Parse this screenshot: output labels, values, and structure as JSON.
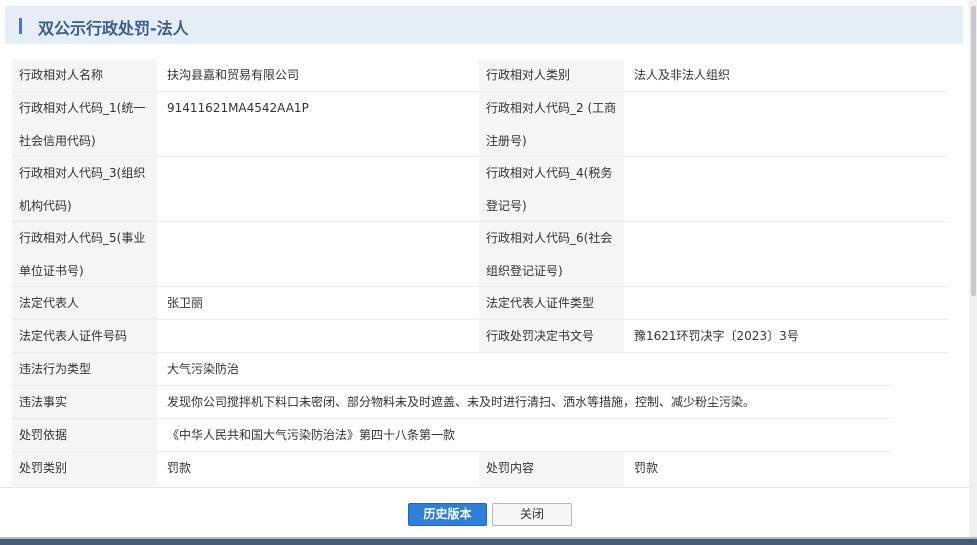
{
  "header": {
    "title": "双公示行政处罚-法人"
  },
  "rows": [
    {
      "label1": "行政相对人名称",
      "value1": "扶沟县嘉和贸易有限公司",
      "label2": "行政相对人类别",
      "value2": "法人及非法人组织"
    },
    {
      "label1_a": "行政相对人代码_1(统一",
      "label1_b": "社会信用代码)",
      "value1": "91411621MA4542AA1P",
      "label2_a": "行政相对人代码_2 (工商",
      "label2_b": "注册号)",
      "value2": ""
    },
    {
      "label1_a": "行政相对人代码_3(组织",
      "label1_b": "机构代码)",
      "value1": "",
      "label2_a": "行政相对人代码_4(税务",
      "label2_b": "登记号)",
      "value2": ""
    },
    {
      "label1_a": "行政相对人代码_5(事业",
      "label1_b": "单位证书号)",
      "value1": "",
      "label2_a": "行政相对人代码_6(社会",
      "label2_b": "组织登记证号)",
      "value2": ""
    },
    {
      "label1": "法定代表人",
      "value1": "张卫丽",
      "label2": "法定代表人证件类型",
      "value2": ""
    },
    {
      "label1": "法定代表人证件号码",
      "value1": "",
      "label2": "行政处罚决定书文号",
      "value2": "豫1621环罚决字〔2023〕3号"
    },
    {
      "label1": "违法行为类型",
      "value1": "大气污染防治"
    },
    {
      "label1": "违法事实",
      "value1": "发现你公司搅拌机下料口未密闭、部分物料未及时遮盖、未及时进行清扫、洒水等措施，控制、减少粉尘污染。"
    },
    {
      "label1": "处罚依据",
      "value1": "《中华人民共和国大气污染防治法》第四十八条第一款"
    },
    {
      "label1": "处罚类别",
      "value1": "罚款",
      "label2": "处罚内容",
      "value2": "罚款"
    }
  ],
  "buttons": {
    "history": "历史版本",
    "close": "关闭"
  },
  "colors": {
    "header_bg": "#e5edf7",
    "accent": "#3a7fd5",
    "primary_button": "#2f7fd8",
    "label_bg": "#f5f5f5"
  }
}
